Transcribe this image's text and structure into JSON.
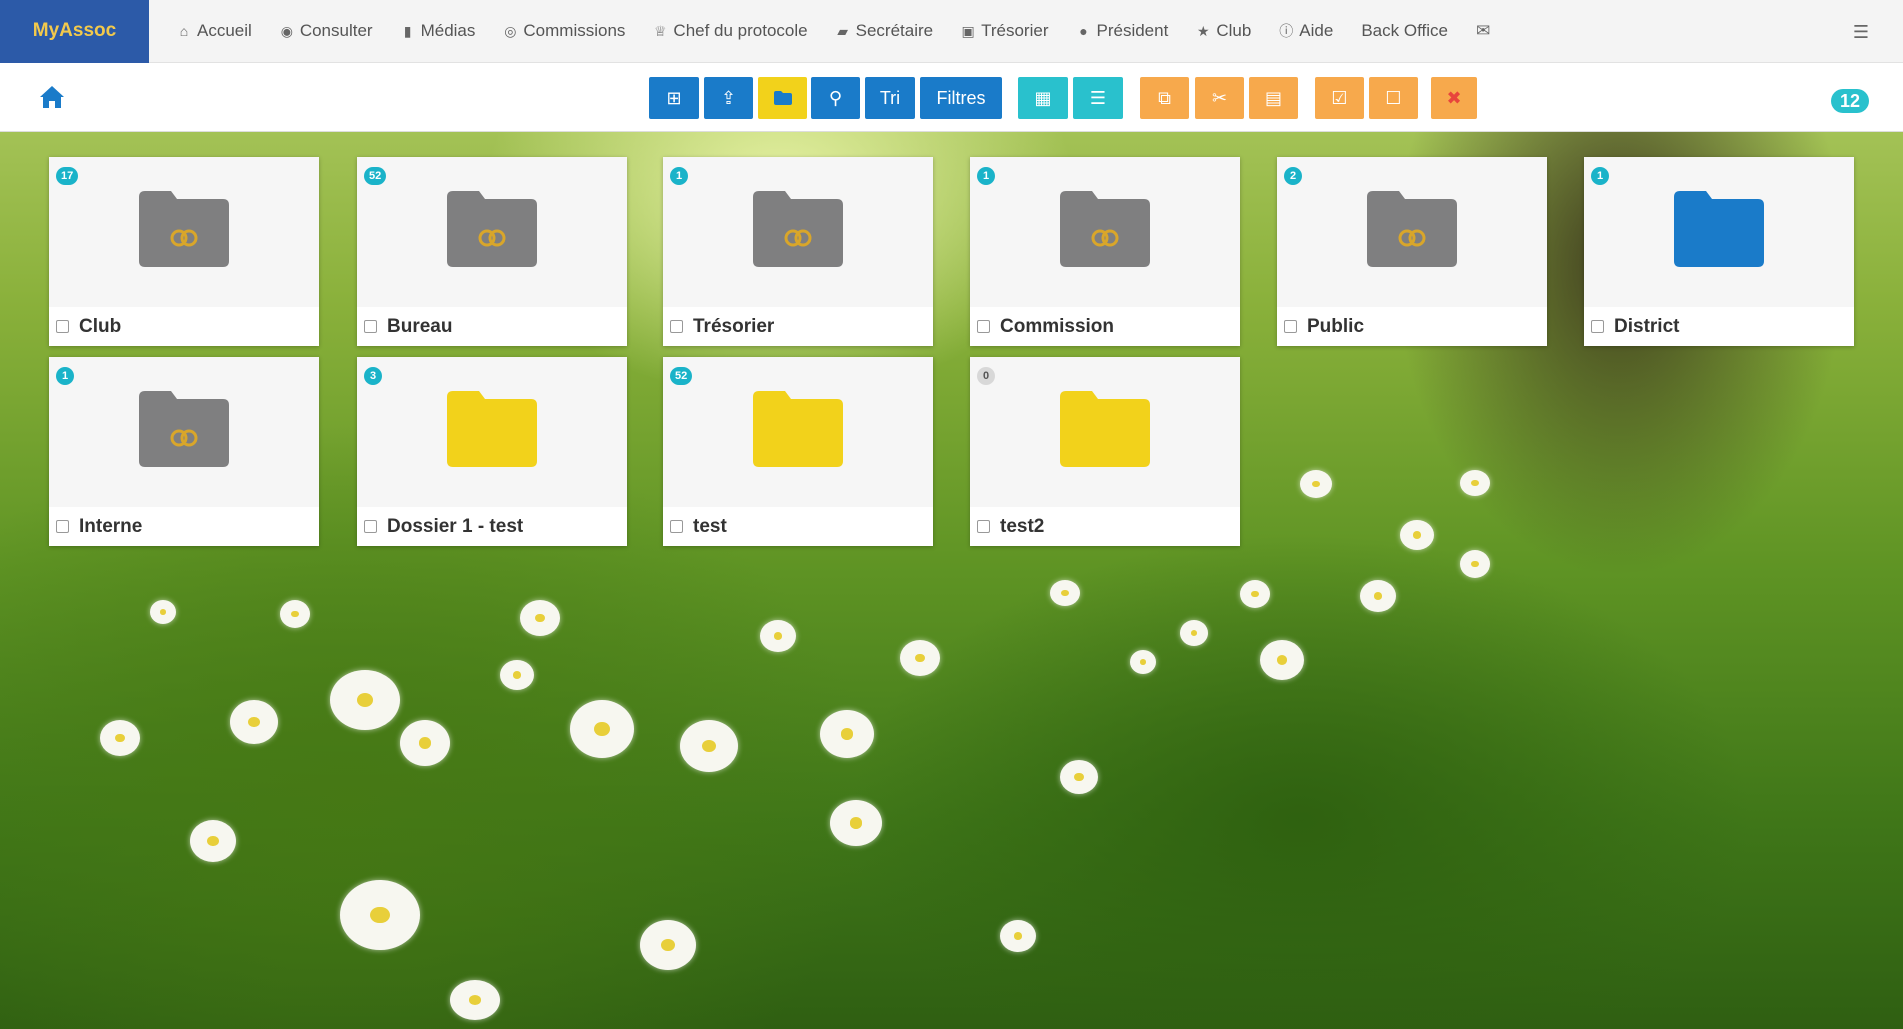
{
  "brand": "MyAssoc",
  "nav": [
    {
      "label": "Accueil",
      "icon": "home-icon"
    },
    {
      "label": "Consulter",
      "icon": "eye-icon"
    },
    {
      "label": "Médias",
      "icon": "file-icon"
    },
    {
      "label": "Commissions",
      "icon": "user-circle-icon"
    },
    {
      "label": "Chef du protocole",
      "icon": "trophy-icon"
    },
    {
      "label": "Secrétaire",
      "icon": "book-icon"
    },
    {
      "label": "Trésorier",
      "icon": "money-icon"
    },
    {
      "label": "Président",
      "icon": "globe-icon"
    },
    {
      "label": "Club",
      "icon": "star-icon"
    },
    {
      "label": "Aide",
      "icon": "info-icon"
    },
    {
      "label": "Back Office",
      "icon": ""
    },
    {
      "label": "",
      "icon": "envelope-icon"
    }
  ],
  "toolbar": {
    "sort_label": "Tri",
    "filters_label": "Filtres",
    "item_count": "12",
    "colors": {
      "blue": "#1a7bc9",
      "yellow": "#f2d21b",
      "teal": "#29c1cd",
      "orange": "#f7a94c"
    }
  },
  "folders": [
    {
      "name": "Club",
      "count": "17",
      "type": "linked"
    },
    {
      "name": "Bureau",
      "count": "52",
      "type": "linked"
    },
    {
      "name": "Trésorier",
      "count": "1",
      "type": "linked"
    },
    {
      "name": "Commission",
      "count": "1",
      "type": "linked"
    },
    {
      "name": "Public",
      "count": "2",
      "type": "linked"
    },
    {
      "name": "District",
      "count": "1",
      "type": "blue"
    },
    {
      "name": "Interne",
      "count": "1",
      "type": "linked"
    },
    {
      "name": "Dossier 1 - test",
      "count": "3",
      "type": "yellow"
    },
    {
      "name": "test",
      "count": "52",
      "type": "yellow"
    },
    {
      "name": "test2",
      "count": "0",
      "type": "yellow"
    }
  ]
}
